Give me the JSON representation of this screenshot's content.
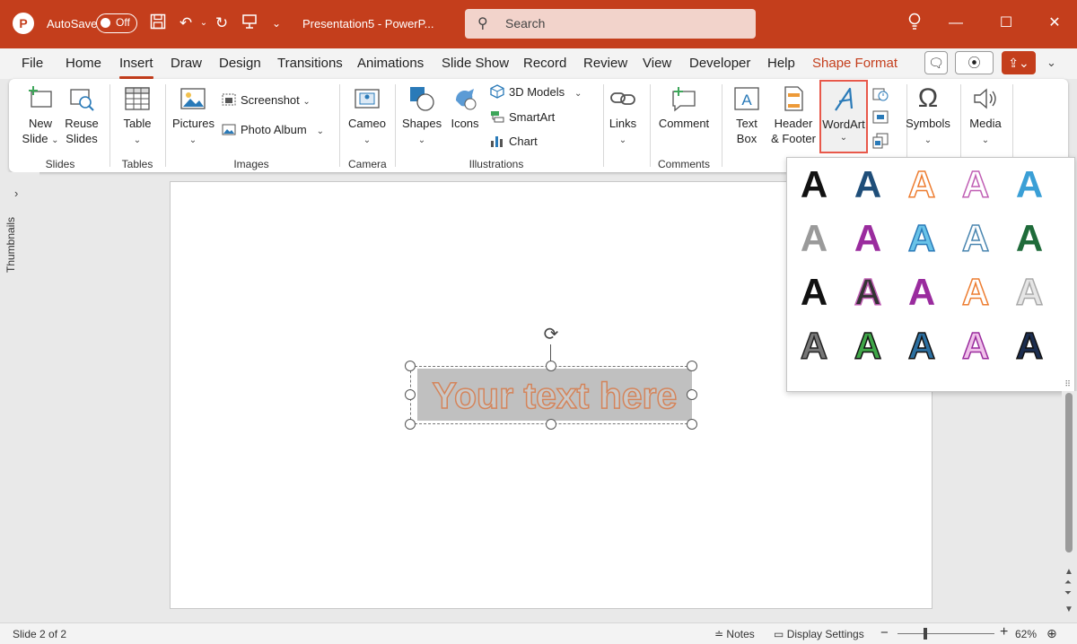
{
  "titlebar": {
    "app_logo": "P",
    "autosave_label": "AutoSave",
    "autosave_state": "Off",
    "doc_title": "Presentation5  -  PowerP...",
    "search_placeholder": "Search",
    "icons": [
      "save-icon",
      "undo-icon",
      "redo-icon",
      "present-icon",
      "customize-icon",
      "lightbulb-icon",
      "minimize-icon",
      "maximize-icon",
      "close-icon"
    ]
  },
  "tabs": [
    {
      "label": "File"
    },
    {
      "label": "Home"
    },
    {
      "label": "Insert",
      "active": true
    },
    {
      "label": "Draw"
    },
    {
      "label": "Design"
    },
    {
      "label": "Transitions"
    },
    {
      "label": "Animations"
    },
    {
      "label": "Slide Show"
    },
    {
      "label": "Record"
    },
    {
      "label": "Review"
    },
    {
      "label": "View"
    },
    {
      "label": "Developer"
    },
    {
      "label": "Help"
    },
    {
      "label": "Shape Format",
      "contextual": true
    }
  ],
  "ribbon": {
    "groups": [
      "Slides",
      "Tables",
      "Images",
      "Camera",
      "Illustrations",
      "Comments"
    ],
    "buttons": {
      "new_slide": "New Slide",
      "new_slide_l1": "New",
      "new_slide_l2": "Slide",
      "reuse_l1": "Reuse",
      "reuse_l2": "Slides",
      "table": "Table",
      "pictures": "Pictures",
      "screenshot": "Screenshot",
      "photo_album": "Photo Album",
      "cameo": "Cameo",
      "shapes": "Shapes",
      "icons": "Icons",
      "models_3d": "3D Models",
      "smartart": "SmartArt",
      "chart": "Chart",
      "links": "Links",
      "comment": "Comment",
      "textbox_l1": "Text",
      "textbox_l2": "Box",
      "header_l1": "Header",
      "header_l2": "& Footer",
      "wordart": "WordArt",
      "symbols": "Symbols",
      "media": "Media"
    }
  },
  "sidebar": {
    "thumbnails_label": "Thumbnails"
  },
  "slide": {
    "placeholder_text": "Your text here"
  },
  "wordart_gallery": {
    "glyph": "A",
    "styles": [
      {
        "fill": "#111111",
        "stroke": "none"
      },
      {
        "fill": "#1f4e79",
        "stroke": "none"
      },
      {
        "fill": "#ffffff",
        "stroke": "#ed7d31"
      },
      {
        "fill": "#ffffff",
        "stroke": "#c05fb4"
      },
      {
        "fill": "#3a9fd6",
        "stroke": "none"
      },
      {
        "fill": "#9a9a9a",
        "stroke": "none"
      },
      {
        "fill": "#9a2c9e",
        "stroke": "none"
      },
      {
        "fill": "#69c3e8",
        "stroke": "#2a7ab8"
      },
      {
        "fill": "#ffffff",
        "stroke": "#4a86b0"
      },
      {
        "fill": "#1f6b3a",
        "stroke": "none"
      },
      {
        "fill": "#111111",
        "stroke": "none"
      },
      {
        "fill": "#333333",
        "stroke": "#c05fb4"
      },
      {
        "fill": "#9a2c9e",
        "stroke": "none"
      },
      {
        "fill": "#ffffff",
        "stroke": "#ed7d31"
      },
      {
        "fill": "#e6e6e6",
        "stroke": "#aaaaaa"
      },
      {
        "fill": "#777777",
        "stroke": "#222222"
      },
      {
        "fill": "#3fa648",
        "stroke": "#111111"
      },
      {
        "fill": "#2c6fa0",
        "stroke": "#111111"
      },
      {
        "fill": "#f0c2ea",
        "stroke": "#9a2c9e"
      },
      {
        "fill": "#1b2d4f",
        "stroke": "#111111"
      }
    ]
  },
  "statusbar": {
    "slide_info": "Slide 2 of 2",
    "notes": "Notes",
    "display_settings": "Display Settings",
    "zoom_minus": "−",
    "zoom_plus": "+",
    "zoom_level": "62%",
    "zoom_fraction": 0.28
  },
  "colors": {
    "accent": "#c43e1c",
    "highlight": "#e8584a"
  }
}
